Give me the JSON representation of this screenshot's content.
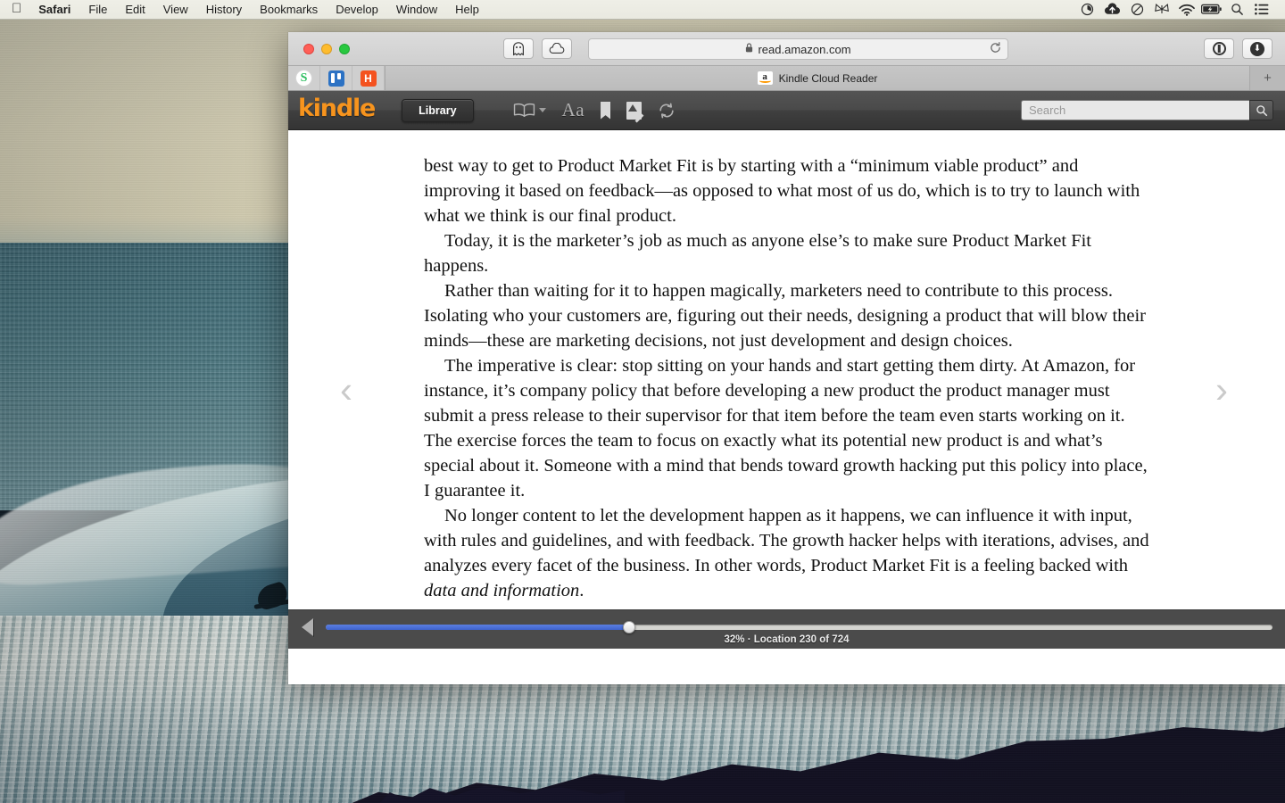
{
  "menubar": {
    "apple_logo": "",
    "items": [
      {
        "label": "Safari",
        "bold": true
      },
      {
        "label": "File"
      },
      {
        "label": "Edit"
      },
      {
        "label": "View"
      },
      {
        "label": "History"
      },
      {
        "label": "Bookmarks"
      },
      {
        "label": "Develop"
      },
      {
        "label": "Window"
      },
      {
        "label": "Help"
      }
    ],
    "status_icons": [
      {
        "name": "time-machine-icon",
        "glyph": "◔"
      },
      {
        "name": "dropbox-upload-icon",
        "glyph": "☁"
      },
      {
        "name": "do-not-disturb-icon",
        "glyph": "⊘"
      },
      {
        "name": "butterfly-icon",
        "glyph": "𝕄"
      },
      {
        "name": "wifi-icon",
        "glyph": "📶"
      },
      {
        "name": "battery-charging-icon",
        "glyph": "🔋"
      },
      {
        "name": "spotlight-search-icon",
        "glyph": "🔍"
      },
      {
        "name": "notification-center-icon",
        "glyph": "☰"
      }
    ]
  },
  "browser": {
    "url": "read.amazon.com",
    "lock_glyph": "🔒",
    "reload_glyph": "↻",
    "sidebar_button": "ghost-icon",
    "cloud_tabs_button": "cloud-icon",
    "reader_button": "reader-mode",
    "downloads_button": "downloads",
    "extensions": [
      {
        "name": "evernote-extension-icon",
        "label": "S"
      },
      {
        "name": "trello-extension-icon",
        "label": ""
      },
      {
        "name": "hubspot-extension-icon",
        "label": "H"
      }
    ],
    "tab": {
      "title": "Kindle Cloud Reader",
      "favicon": "amazon-favicon",
      "favicon_letter": "a"
    },
    "new_tab_label": "+"
  },
  "kindle": {
    "logo": "kindle",
    "library_label": "Library",
    "tools": [
      {
        "name": "view-mode-icon",
        "glyph": "▥"
      },
      {
        "name": "font-settings-icon",
        "glyph": "Aa"
      },
      {
        "name": "bookmark-icon",
        "glyph": "🔖"
      },
      {
        "name": "notes-and-marks-icon",
        "glyph": "📝"
      },
      {
        "name": "sync-icon",
        "glyph": "⟳"
      }
    ],
    "search_placeholder": "Search",
    "search_value": "",
    "search_button_glyph": "🔍",
    "nav_prev_glyph": "‹",
    "nav_next_glyph": "›",
    "accent_color": "#f7941e",
    "progress": {
      "percent": 32,
      "location_current": 230,
      "location_total": 724,
      "status_text": "32% · Location 230 of 724"
    },
    "page": {
      "paragraphs": [
        {
          "indent": false,
          "text": "best way to get to Product Market Fit is by starting with a “minimum viable product” and improving it based on feedback—as opposed to what most of us do, which is to try to launch with what we think is our final product."
        },
        {
          "indent": true,
          "text": "Today, it is the marketer’s job as much as anyone else’s to make sure Product Market Fit happens."
        },
        {
          "indent": true,
          "text": "Rather than waiting for it to happen magically, marketers need to contribute to this process. Isolating who your customers are, figuring out their needs, designing a product that will blow their minds—these are marketing decisions, not just development and design choices."
        },
        {
          "indent": true,
          "text": "The imperative is clear: stop sitting on your hands and start getting them dirty. At Amazon, for instance, it’s company policy that before developing a new product the product manager must submit a press release to their supervisor for that item before the team even starts working on it. The exercise forces the team to focus on exactly what its potential new product is and what’s special about it. Someone with a mind that bends toward growth hacking put this policy into place, I guarantee it."
        },
        {
          "indent": true,
          "text": "No longer content to let the development happen as it happens, we can influence it with input, with rules and guidelines, and with feedback. The growth hacker helps with iterations, advises, and analyzes every facet of the business. In other words, Product Market Fit is a feeling backed with ",
          "italic_tail": "data and information",
          "tail": "."
        }
      ]
    }
  }
}
